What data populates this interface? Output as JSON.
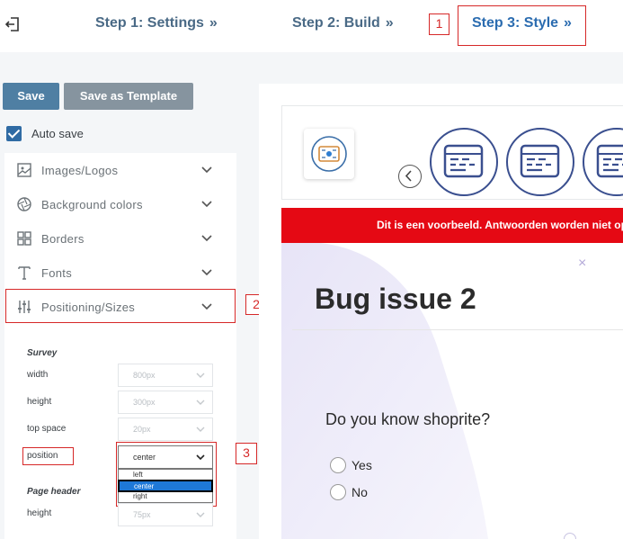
{
  "steps": {
    "step1": "Step 1: Settings",
    "step2": "Step 2: Build",
    "step3": "Step 3: Style",
    "arrows": "»"
  },
  "callouts": [
    "1",
    "2",
    "3"
  ],
  "toolbar": {
    "save_label": "Save",
    "save_template_label": "Save as Template",
    "autosave_label": "Auto save",
    "autosave_checked": true
  },
  "menu": {
    "items": [
      {
        "label": "Images/Logos",
        "icon": "image-icon"
      },
      {
        "label": "Background colors",
        "icon": "aperture-icon"
      },
      {
        "label": "Borders",
        "icon": "grid-icon"
      },
      {
        "label": "Fonts",
        "icon": "text-icon"
      },
      {
        "label": "Positioning/Sizes",
        "icon": "sliders-icon",
        "expanded": true
      }
    ]
  },
  "positioning": {
    "survey_heading": "Survey",
    "fields": [
      {
        "label": "width",
        "value": "800px"
      },
      {
        "label": "height",
        "value": "300px"
      },
      {
        "label": "top space",
        "value": "20px"
      },
      {
        "label": "position",
        "value": "center"
      }
    ],
    "position_options": [
      "left",
      "center",
      "right"
    ],
    "position_selected": "center",
    "page_header_heading": "Page header",
    "page_header_fields": [
      {
        "label": "height",
        "value": "75px"
      }
    ]
  },
  "preview": {
    "banner_text": "Dit is een voorbeeld. Antwoorden worden niet opgeslagen.",
    "close_symbol": "×",
    "survey_title": "Bug issue 2",
    "question": "Do you know shoprite?",
    "answers": [
      "Yes",
      "No"
    ]
  },
  "colors": {
    "accent": "#2b6cb0",
    "save_button": "#4f7fa3",
    "template_button": "#86949f",
    "banner": "#e50914",
    "callout": "#d62828",
    "card_outline": "#3a4f8f"
  }
}
